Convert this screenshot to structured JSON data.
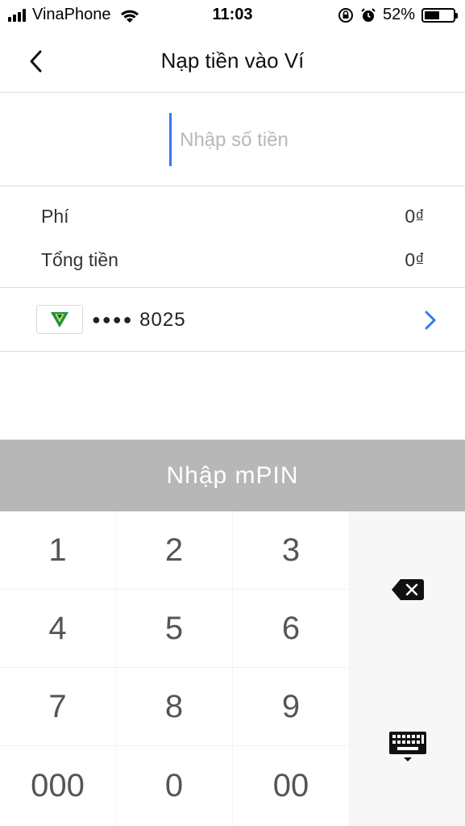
{
  "status_bar": {
    "carrier": "VinaPhone",
    "time": "11:03",
    "battery_percent_label": "52%",
    "battery_level": 0.52
  },
  "header": {
    "title": "Nạp tiền vào Ví"
  },
  "amount": {
    "placeholder": "Nhập số tiền",
    "value": ""
  },
  "fees": {
    "fee_label": "Phí",
    "fee_value": "0₫",
    "total_label": "Tổng tiền",
    "total_value": "0₫"
  },
  "card": {
    "mask_dots": "●●●●",
    "last_digits": "8025"
  },
  "mpin": {
    "label": "Nhập mPIN"
  },
  "keypad": {
    "keys": [
      "1",
      "2",
      "3",
      "4",
      "5",
      "6",
      "7",
      "8",
      "9",
      "000",
      "0",
      "00"
    ]
  },
  "colors": {
    "accent": "#3478f6",
    "mpin_bar": "#b7b7b7",
    "bank_green": "#1e8e3e"
  }
}
